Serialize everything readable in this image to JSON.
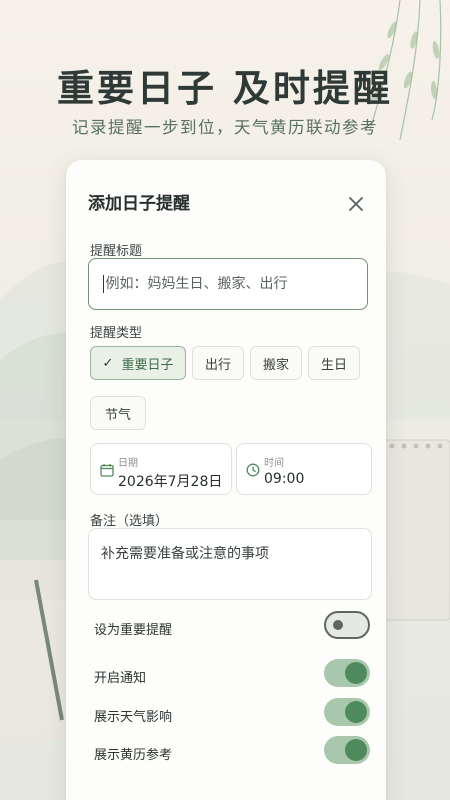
{
  "hero": {
    "title": "重要日子  及时提醒",
    "subtitle": "记录提醒一步到位，天气黄历联动参考"
  },
  "dialog": {
    "title": "添加日子提醒",
    "title_field_label": "提醒标题",
    "title_field_placeholder": "例如：妈妈生日、搬家、出行",
    "type_label": "提醒类型",
    "types": [
      {
        "label": "重要日子",
        "selected": true
      },
      {
        "label": "出行",
        "selected": false
      },
      {
        "label": "搬家",
        "selected": false
      },
      {
        "label": "生日",
        "selected": false
      },
      {
        "label": "节气",
        "selected": false
      }
    ],
    "date": {
      "caption": "日期",
      "value": "2026年7月28日"
    },
    "time": {
      "caption": "时间",
      "value": "09:00"
    },
    "note_label": "备注（选填）",
    "note_placeholder": "补充需要准备或注意的事项",
    "toggles": [
      {
        "label": "设为重要提醒",
        "on": false
      },
      {
        "label": "开启通知",
        "on": true
      },
      {
        "label": "展示天气影响",
        "on": true
      },
      {
        "label": "展示黄历参考",
        "on": true
      }
    ]
  },
  "colors": {
    "accent": "#4f8a5c",
    "accent_light": "#a9c7ad",
    "chip_active_bg": "#e9f0e6",
    "title_text": "#2f3a37"
  },
  "icons": [
    "close-icon",
    "check-icon",
    "calendar-icon",
    "clock-icon"
  ]
}
